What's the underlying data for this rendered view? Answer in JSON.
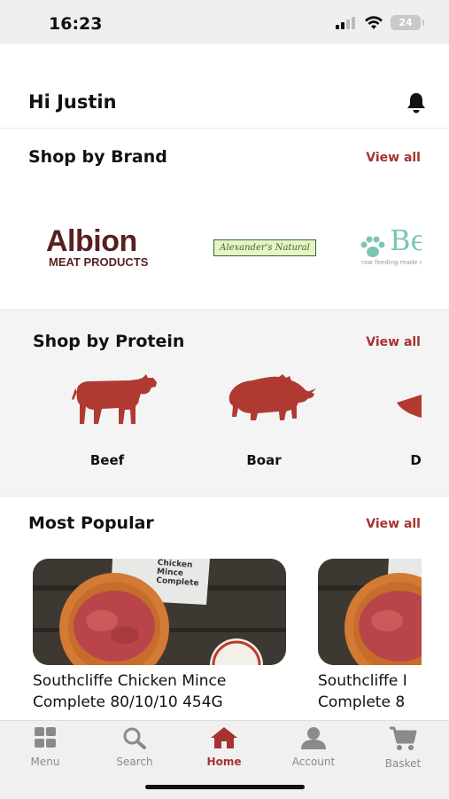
{
  "status_bar": {
    "time": "16:23",
    "battery": "24"
  },
  "header": {
    "greeting": "Hi Justin"
  },
  "brand_section": {
    "title": "Shop by Brand",
    "view_all": "View all",
    "brands": [
      {
        "name": "Albion",
        "subtitle": "MEAT PRODUCTS"
      },
      {
        "name": "Alexander's Natural"
      },
      {
        "name": "Be",
        "tagline": "raw feeding made s"
      }
    ]
  },
  "protein_section": {
    "title": "Shop by Protein",
    "view_all": "View all",
    "proteins": [
      {
        "label": "Beef",
        "icon": "cow-icon"
      },
      {
        "label": "Boar",
        "icon": "boar-icon"
      },
      {
        "label": "Du",
        "icon": "duck-icon"
      }
    ],
    "icon_color": "#b03a32"
  },
  "popular_section": {
    "title": "Most Popular",
    "view_all": "View all",
    "products": [
      {
        "line1": "Southcliffe Chicken Mince",
        "line2": "Complete 80/10/10 454G",
        "package_label": "Chicken Mince Complete"
      },
      {
        "line1": "Southcliffe I",
        "line2": "Complete 8",
        "package_label": ""
      }
    ]
  },
  "tab_bar": {
    "tabs": [
      {
        "label": "Menu",
        "icon": "grid-icon"
      },
      {
        "label": "Search",
        "icon": "search-icon"
      },
      {
        "label": "Home",
        "icon": "home-icon",
        "active": true
      },
      {
        "label": "Account",
        "icon": "account-icon"
      },
      {
        "label": "Basket",
        "icon": "basket-icon"
      }
    ],
    "active_color": "#a83232",
    "inactive_color": "#8a8a8a"
  }
}
